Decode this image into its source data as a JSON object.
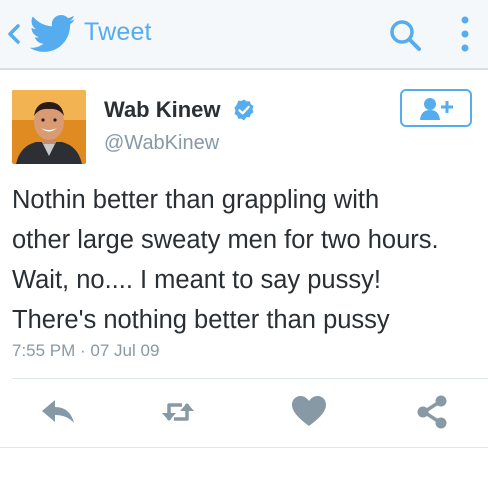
{
  "header": {
    "title": "Tweet",
    "back_icon": "chevron-left-icon",
    "logo_icon": "twitter-bird-icon",
    "search_icon": "search-icon",
    "menu_icon": "vertical-dots-icon"
  },
  "user": {
    "display_name": "Wab Kinew",
    "handle": "@WabKinew",
    "verified": true
  },
  "tweet": {
    "lines": [
      "Nothin better than grappling with",
      "other large sweaty men for two hours.",
      "Wait, no.... I meant to say pussy!",
      "There's nothing better than pussy"
    ],
    "time": "7:55 PM",
    "separator": " · ",
    "date": "07 Jul 09"
  },
  "actions": [
    "reply-icon",
    "retweet-icon",
    "heart-icon",
    "share-icon"
  ],
  "colors": {
    "brand": "#55acee",
    "text": "#292f33",
    "muted": "#8899a6",
    "icons": "#8899a6"
  }
}
